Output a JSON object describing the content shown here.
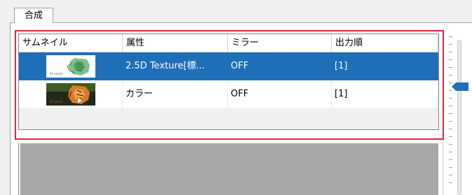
{
  "tab": {
    "label": "合成"
  },
  "listview": {
    "columns": [
      "サムネイル",
      "属性",
      "ミラー",
      "出力順"
    ],
    "rows": [
      {
        "thumbnail": "tiger-texture-thumbnail",
        "attribute": "2.5D Texture[標...",
        "mirror": "OFF",
        "order": "[1]",
        "selected": true
      },
      {
        "thumbnail": "tiger-color-thumbnail",
        "attribute": "カラー",
        "mirror": "OFF",
        "order": "[1]",
        "selected": false
      }
    ]
  },
  "slider": {
    "level": 0.3
  },
  "colors": {
    "selection": "#1e6fb8",
    "highlight_border": "#e0263a",
    "empty_area": "#a8a8a8",
    "slider_thumb": "#1e6fb8"
  }
}
